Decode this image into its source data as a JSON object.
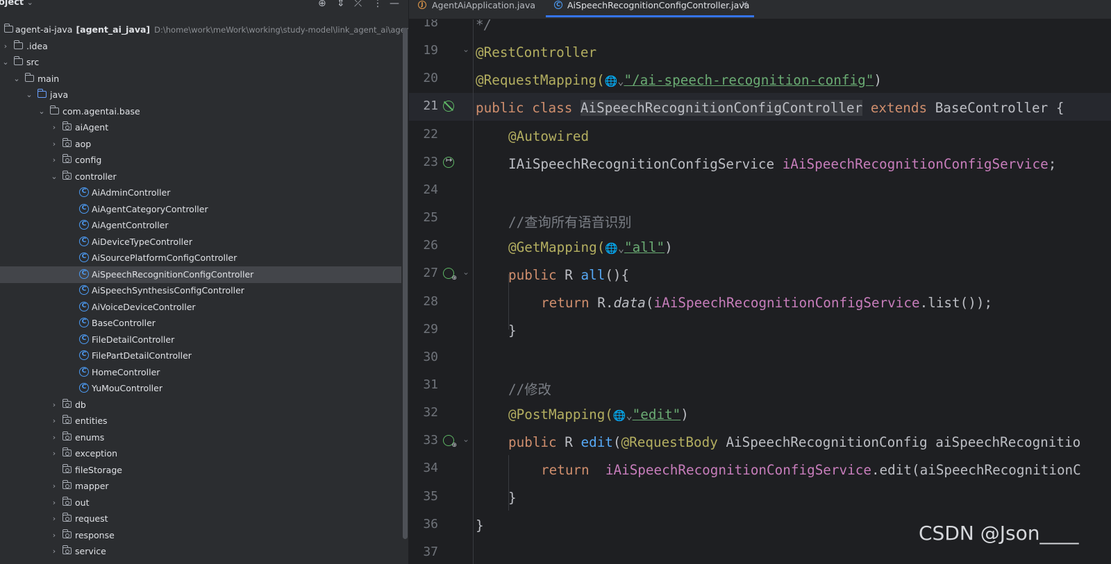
{
  "project_panel": {
    "title": "oject",
    "title_chevron": "⌄",
    "root_name": "agent-ai-java",
    "root_module": "[agent_ai_java]",
    "root_path": "D:\\home\\work\\meWork\\working\\study-model\\link_agent_ai\\agent-ai-",
    "tree": [
      {
        "label": "agent-ai-java",
        "type": "root",
        "depth": 0,
        "chev": "⌄"
      },
      {
        "label": ".idea",
        "type": "folder",
        "depth": 0,
        "chev": "›"
      },
      {
        "label": "src",
        "type": "folder",
        "depth": 0,
        "chev": "⌄"
      },
      {
        "label": "main",
        "type": "folder",
        "depth": 1,
        "chev": "⌄"
      },
      {
        "label": "java",
        "type": "java",
        "depth": 2,
        "chev": "⌄"
      },
      {
        "label": "com.agentai.base",
        "type": "folder",
        "depth": 3,
        "chev": "⌄"
      },
      {
        "label": "aiAgent",
        "type": "pkg",
        "depth": 4,
        "chev": "›"
      },
      {
        "label": "aop",
        "type": "pkg",
        "depth": 4,
        "chev": "›"
      },
      {
        "label": "config",
        "type": "pkg",
        "depth": 4,
        "chev": "›"
      },
      {
        "label": "controller",
        "type": "pkg",
        "depth": 4,
        "chev": "⌄"
      },
      {
        "label": "AiAdminController",
        "type": "class",
        "depth": 5
      },
      {
        "label": "AiAgentCategoryController",
        "type": "class",
        "depth": 5
      },
      {
        "label": "AiAgentController",
        "type": "class",
        "depth": 5
      },
      {
        "label": "AiDeviceTypeController",
        "type": "class",
        "depth": 5
      },
      {
        "label": "AiSourcePlatformConfigController",
        "type": "class",
        "depth": 5
      },
      {
        "label": "AiSpeechRecognitionConfigController",
        "type": "class",
        "depth": 5,
        "selected": true
      },
      {
        "label": "AiSpeechSynthesisConfigController",
        "type": "class",
        "depth": 5
      },
      {
        "label": "AiVoiceDeviceController",
        "type": "class",
        "depth": 5
      },
      {
        "label": "BaseController",
        "type": "class",
        "depth": 5
      },
      {
        "label": "FileDetailController",
        "type": "class",
        "depth": 5
      },
      {
        "label": "FilePartDetailController",
        "type": "class",
        "depth": 5
      },
      {
        "label": "HomeController",
        "type": "class",
        "depth": 5
      },
      {
        "label": "YuMouController",
        "type": "class",
        "depth": 5
      },
      {
        "label": "db",
        "type": "pkg",
        "depth": 4,
        "chev": "›"
      },
      {
        "label": "entities",
        "type": "pkg",
        "depth": 4,
        "chev": "›"
      },
      {
        "label": "enums",
        "type": "pkg",
        "depth": 4,
        "chev": "›"
      },
      {
        "label": "exception",
        "type": "pkg",
        "depth": 4,
        "chev": "›"
      },
      {
        "label": "fileStorage",
        "type": "pkg",
        "depth": 4,
        "chev": ""
      },
      {
        "label": "mapper",
        "type": "pkg",
        "depth": 4,
        "chev": "›"
      },
      {
        "label": "out",
        "type": "pkg",
        "depth": 4,
        "chev": "›"
      },
      {
        "label": "request",
        "type": "pkg",
        "depth": 4,
        "chev": "›"
      },
      {
        "label": "response",
        "type": "pkg",
        "depth": 4,
        "chev": "›"
      },
      {
        "label": "service",
        "type": "pkg",
        "depth": 4,
        "chev": "›"
      }
    ]
  },
  "header_icons": {
    "locate": "⊕",
    "expand": "⇕",
    "collapse": "⤫",
    "more": "⋮",
    "hide": "—"
  },
  "tabs": [
    {
      "label": "AgentAiApplication.java",
      "active": false,
      "icon": "java-file-icon"
    },
    {
      "label": "AiSpeechRecognitionConfigController.java",
      "active": true,
      "icon": "class-icon",
      "close": "×"
    }
  ],
  "editor": {
    "line_numbers": [
      "18",
      "19",
      "20",
      "21",
      "22",
      "23",
      "24",
      "25",
      "26",
      "27",
      "28",
      "29",
      "30",
      "31",
      "32",
      "33",
      "34",
      "35",
      "36",
      "37"
    ],
    "code": {
      "l18": "*/",
      "l19": "@RestController",
      "l20_ann": "@RequestMapping(",
      "l20_str": "\"/ai-speech-recognition-config\"",
      "l20_end": ")",
      "l21_kw": "public class ",
      "l21_name": "AiSpeechRecognitionConfigController",
      "l21_ext": " extends ",
      "l21_base": "BaseController {",
      "l22": "@Autowired",
      "l23_type": "IAiSpeechRecognitionConfigService ",
      "l23_field": "iAiSpeechRecognitionConfigService",
      "l23_end": ";",
      "l25": "//查询所有语音识别",
      "l26_ann": "@GetMapping(",
      "l26_str": "\"all\"",
      "l26_end": ")",
      "l27_kw": "public ",
      "l27_type": "R",
      "l27_fn": " all",
      "l27_end": "(){",
      "l28_kw": "return ",
      "l28_r": "R.",
      "l28_data": "data",
      "l28_p": "(",
      "l28_field": "iAiSpeechRecognitionConfigService",
      "l28_end": ".list());",
      "l29": "}",
      "l31": "//修改",
      "l32_ann": "@PostMapping(",
      "l32_str": "\"edit\"",
      "l32_end": ")",
      "l33_kw": "public ",
      "l33_type": "R",
      "l33_fn": " edit",
      "l33_p": "(",
      "l33_ann": "@RequestBody",
      "l33_rest": " AiSpeechRecognitionConfig aiSpeechRecognitio",
      "l34_kw": "return  ",
      "l34_field": "iAiSpeechRecognitionConfigService",
      "l34_rest": ".edit(aiSpeechRecognitionC",
      "l35": "}",
      "l36": "}"
    },
    "globe_glyph": "🌐⌄"
  },
  "watermark": "CSDN @Json____"
}
